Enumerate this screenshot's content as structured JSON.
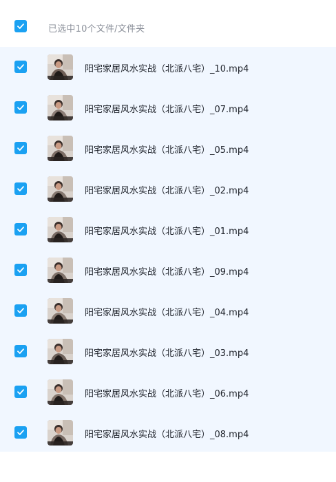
{
  "header": {
    "select_all_checked": true,
    "summary_text": "已选中10个文件/文件夹"
  },
  "colors": {
    "accent": "#1ba1f2",
    "list_background": "#f1f7ff",
    "filename_text": "#1d2129",
    "header_text": "#8a8f99"
  },
  "files": [
    {
      "name": "阳宅家居风水实战（北派八宅）_10.mp4",
      "checked": true,
      "icon": "video-thumbnail"
    },
    {
      "name": "阳宅家居风水实战（北派八宅）_07.mp4",
      "checked": true,
      "icon": "video-thumbnail"
    },
    {
      "name": "阳宅家居风水实战（北派八宅）_05.mp4",
      "checked": true,
      "icon": "video-thumbnail"
    },
    {
      "name": "阳宅家居风水实战（北派八宅）_02.mp4",
      "checked": true,
      "icon": "video-thumbnail"
    },
    {
      "name": "阳宅家居风水实战（北派八宅）_01.mp4",
      "checked": true,
      "icon": "video-thumbnail"
    },
    {
      "name": "阳宅家居风水实战（北派八宅）_09.mp4",
      "checked": true,
      "icon": "video-thumbnail"
    },
    {
      "name": "阳宅家居风水实战（北派八宅）_04.mp4",
      "checked": true,
      "icon": "video-thumbnail"
    },
    {
      "name": "阳宅家居风水实战（北派八宅）_03.mp4",
      "checked": true,
      "icon": "video-thumbnail"
    },
    {
      "name": "阳宅家居风水实战（北派八宅）_06.mp4",
      "checked": true,
      "icon": "video-thumbnail"
    },
    {
      "name": "阳宅家居风水实战（北派八宅）_08.mp4",
      "checked": true,
      "icon": "video-thumbnail"
    }
  ]
}
